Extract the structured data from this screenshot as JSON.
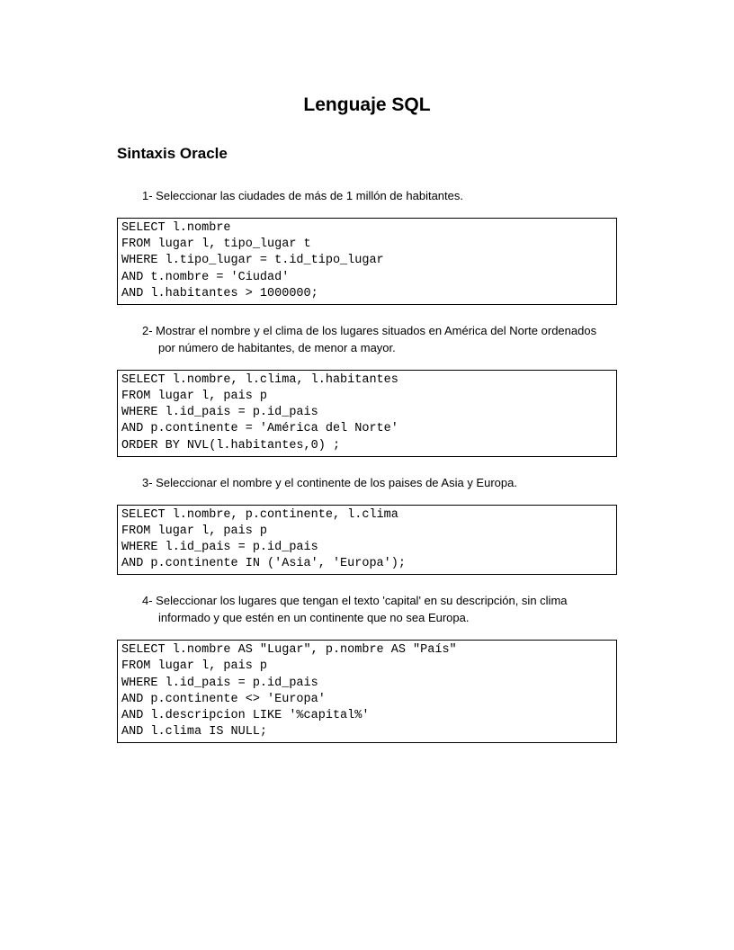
{
  "title": "Lenguaje SQL",
  "section": "Sintaxis Oracle",
  "items": [
    {
      "question": "1- Seleccionar las ciudades de más de 1 millón de habitantes.",
      "code": "SELECT l.nombre\nFROM lugar l, tipo_lugar t\nWHERE l.tipo_lugar = t.id_tipo_lugar\nAND t.nombre = 'Ciudad'\nAND l.habitantes > 1000000;"
    },
    {
      "question": "2- Mostrar el nombre y el clima de los lugares situados en América del Norte ordenados por número de habitantes, de menor a mayor.",
      "code": "SELECT l.nombre, l.clima, l.habitantes\nFROM lugar l, pais p\nWHERE l.id_pais = p.id_pais\nAND p.continente = 'América del Norte'\nORDER BY NVL(l.habitantes,0) ;"
    },
    {
      "question": "3- Seleccionar el nombre y el continente de los paises de Asia y Europa.",
      "code": "SELECT l.nombre, p.continente, l.clima\nFROM lugar l, pais p\nWHERE l.id_pais = p.id_pais\nAND p.continente IN ('Asia', 'Europa');"
    },
    {
      "question": "4- Seleccionar los lugares que tengan el texto 'capital' en su descripción, sin clima informado y que estén en un continente que no sea Europa.",
      "code": "SELECT l.nombre AS \"Lugar\", p.nombre AS \"País\"\nFROM lugar l, pais p\nWHERE l.id_pais = p.id_pais\nAND p.continente <> 'Europa'\nAND l.descripcion LIKE '%capital%'\nAND l.clima IS NULL;"
    }
  ]
}
